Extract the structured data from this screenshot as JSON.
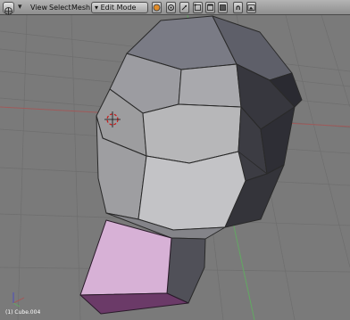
{
  "header": {
    "view_label": "View",
    "select_label": "Select",
    "mesh_label": "Mesh",
    "mode_label": "Edit Mode",
    "mode_arrow": "▾",
    "collapse_glyph": "▾",
    "magnet_glyph": "∩"
  },
  "viewport": {
    "object_info": "(1) Cube.004",
    "background_color": "#7a7a7a",
    "grid_color": "#6d6d6d",
    "x_axis_color": "#a05858",
    "y_axis_color": "#62a862",
    "selected_face_color": "#d9b3d9",
    "mesh_face_color": "#b8b8b8"
  }
}
